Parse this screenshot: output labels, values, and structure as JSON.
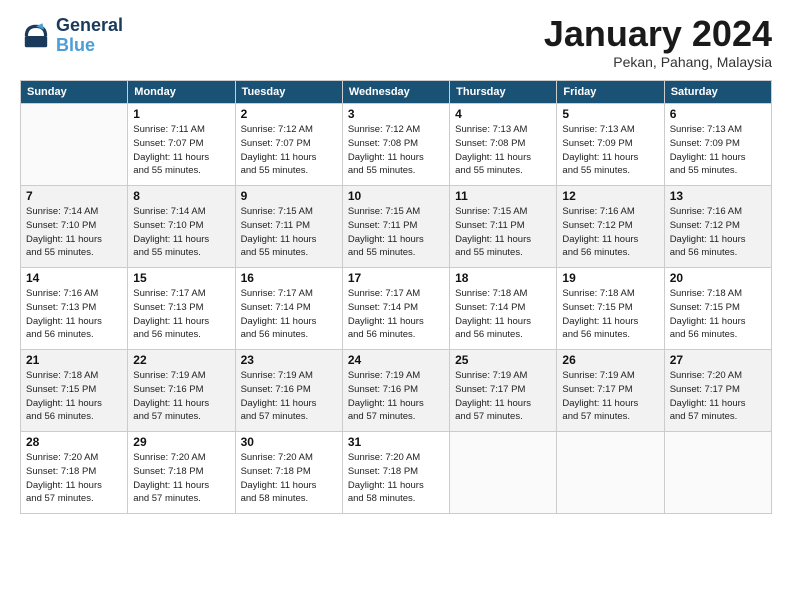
{
  "header": {
    "logo_line1": "General",
    "logo_line2": "Blue",
    "month": "January 2024",
    "location": "Pekan, Pahang, Malaysia"
  },
  "days_of_week": [
    "Sunday",
    "Monday",
    "Tuesday",
    "Wednesday",
    "Thursday",
    "Friday",
    "Saturday"
  ],
  "weeks": [
    [
      {
        "day": "",
        "info": ""
      },
      {
        "day": "1",
        "info": "Sunrise: 7:11 AM\nSunset: 7:07 PM\nDaylight: 11 hours\nand 55 minutes."
      },
      {
        "day": "2",
        "info": "Sunrise: 7:12 AM\nSunset: 7:07 PM\nDaylight: 11 hours\nand 55 minutes."
      },
      {
        "day": "3",
        "info": "Sunrise: 7:12 AM\nSunset: 7:08 PM\nDaylight: 11 hours\nand 55 minutes."
      },
      {
        "day": "4",
        "info": "Sunrise: 7:13 AM\nSunset: 7:08 PM\nDaylight: 11 hours\nand 55 minutes."
      },
      {
        "day": "5",
        "info": "Sunrise: 7:13 AM\nSunset: 7:09 PM\nDaylight: 11 hours\nand 55 minutes."
      },
      {
        "day": "6",
        "info": "Sunrise: 7:13 AM\nSunset: 7:09 PM\nDaylight: 11 hours\nand 55 minutes."
      }
    ],
    [
      {
        "day": "7",
        "info": "Sunrise: 7:14 AM\nSunset: 7:10 PM\nDaylight: 11 hours\nand 55 minutes."
      },
      {
        "day": "8",
        "info": "Sunrise: 7:14 AM\nSunset: 7:10 PM\nDaylight: 11 hours\nand 55 minutes."
      },
      {
        "day": "9",
        "info": "Sunrise: 7:15 AM\nSunset: 7:11 PM\nDaylight: 11 hours\nand 55 minutes."
      },
      {
        "day": "10",
        "info": "Sunrise: 7:15 AM\nSunset: 7:11 PM\nDaylight: 11 hours\nand 55 minutes."
      },
      {
        "day": "11",
        "info": "Sunrise: 7:15 AM\nSunset: 7:11 PM\nDaylight: 11 hours\nand 55 minutes."
      },
      {
        "day": "12",
        "info": "Sunrise: 7:16 AM\nSunset: 7:12 PM\nDaylight: 11 hours\nand 56 minutes."
      },
      {
        "day": "13",
        "info": "Sunrise: 7:16 AM\nSunset: 7:12 PM\nDaylight: 11 hours\nand 56 minutes."
      }
    ],
    [
      {
        "day": "14",
        "info": "Sunrise: 7:16 AM\nSunset: 7:13 PM\nDaylight: 11 hours\nand 56 minutes."
      },
      {
        "day": "15",
        "info": "Sunrise: 7:17 AM\nSunset: 7:13 PM\nDaylight: 11 hours\nand 56 minutes."
      },
      {
        "day": "16",
        "info": "Sunrise: 7:17 AM\nSunset: 7:14 PM\nDaylight: 11 hours\nand 56 minutes."
      },
      {
        "day": "17",
        "info": "Sunrise: 7:17 AM\nSunset: 7:14 PM\nDaylight: 11 hours\nand 56 minutes."
      },
      {
        "day": "18",
        "info": "Sunrise: 7:18 AM\nSunset: 7:14 PM\nDaylight: 11 hours\nand 56 minutes."
      },
      {
        "day": "19",
        "info": "Sunrise: 7:18 AM\nSunset: 7:15 PM\nDaylight: 11 hours\nand 56 minutes."
      },
      {
        "day": "20",
        "info": "Sunrise: 7:18 AM\nSunset: 7:15 PM\nDaylight: 11 hours\nand 56 minutes."
      }
    ],
    [
      {
        "day": "21",
        "info": "Sunrise: 7:18 AM\nSunset: 7:15 PM\nDaylight: 11 hours\nand 56 minutes."
      },
      {
        "day": "22",
        "info": "Sunrise: 7:19 AM\nSunset: 7:16 PM\nDaylight: 11 hours\nand 57 minutes."
      },
      {
        "day": "23",
        "info": "Sunrise: 7:19 AM\nSunset: 7:16 PM\nDaylight: 11 hours\nand 57 minutes."
      },
      {
        "day": "24",
        "info": "Sunrise: 7:19 AM\nSunset: 7:16 PM\nDaylight: 11 hours\nand 57 minutes."
      },
      {
        "day": "25",
        "info": "Sunrise: 7:19 AM\nSunset: 7:17 PM\nDaylight: 11 hours\nand 57 minutes."
      },
      {
        "day": "26",
        "info": "Sunrise: 7:19 AM\nSunset: 7:17 PM\nDaylight: 11 hours\nand 57 minutes."
      },
      {
        "day": "27",
        "info": "Sunrise: 7:20 AM\nSunset: 7:17 PM\nDaylight: 11 hours\nand 57 minutes."
      }
    ],
    [
      {
        "day": "28",
        "info": "Sunrise: 7:20 AM\nSunset: 7:18 PM\nDaylight: 11 hours\nand 57 minutes."
      },
      {
        "day": "29",
        "info": "Sunrise: 7:20 AM\nSunset: 7:18 PM\nDaylight: 11 hours\nand 57 minutes."
      },
      {
        "day": "30",
        "info": "Sunrise: 7:20 AM\nSunset: 7:18 PM\nDaylight: 11 hours\nand 58 minutes."
      },
      {
        "day": "31",
        "info": "Sunrise: 7:20 AM\nSunset: 7:18 PM\nDaylight: 11 hours\nand 58 minutes."
      },
      {
        "day": "",
        "info": ""
      },
      {
        "day": "",
        "info": ""
      },
      {
        "day": "",
        "info": ""
      }
    ]
  ]
}
